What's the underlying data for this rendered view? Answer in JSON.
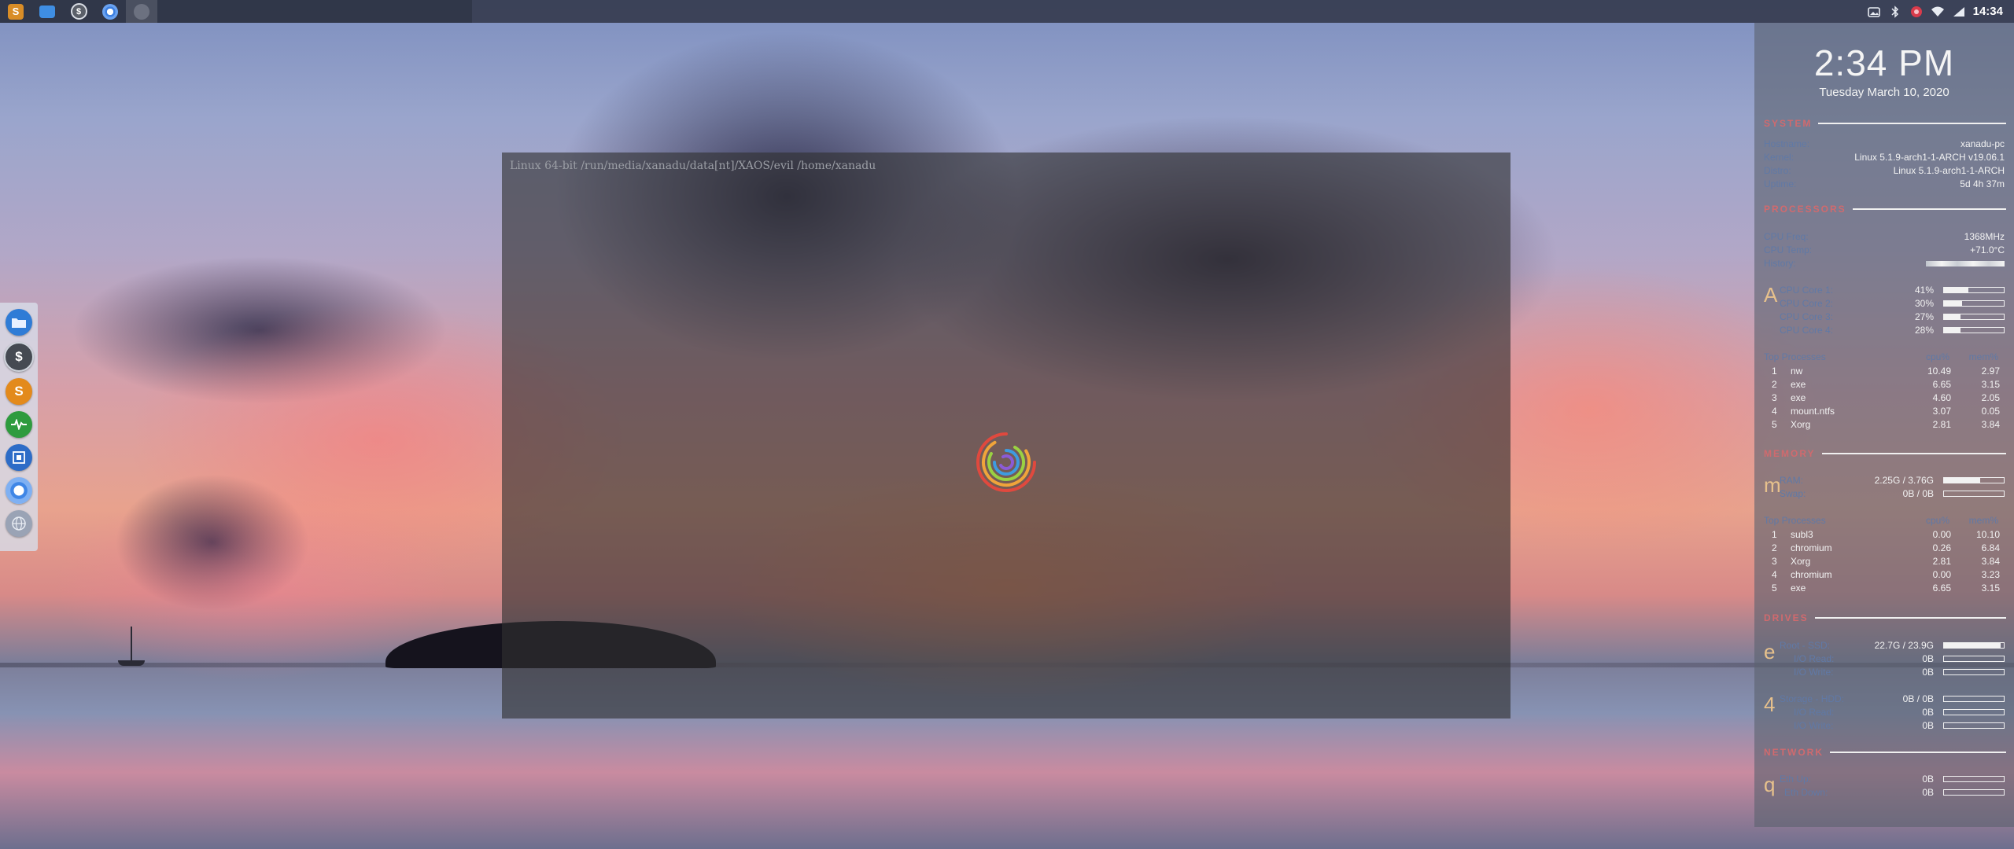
{
  "colors": {
    "conky_section_title": "#d06a6e",
    "conky_label": "#6079a6",
    "conky_value": "#f2f2f2",
    "conky_big_letter": "#e7c18c"
  },
  "topbar": {
    "apps": [
      {
        "icon": "sublime-text-icon",
        "glyph": "S",
        "color": "#d98d27"
      },
      {
        "icon": "folder-icon",
        "glyph": "",
        "color": "#3f8ee3"
      },
      {
        "icon": "terminal-icon",
        "glyph": "$",
        "color": "#5a5f69"
      },
      {
        "icon": "chromium-icon",
        "glyph": "",
        "color": "#3c7fe0"
      },
      {
        "icon": "system-monitor-icon",
        "glyph": "",
        "color": "#6c7180"
      }
    ],
    "tray_icons": [
      "screenshot-icon",
      "bluetooth-icon",
      "notification-icon",
      "wifi-icon",
      "battery-icon"
    ],
    "time": "14:34"
  },
  "dock": {
    "items": [
      {
        "name": "files",
        "icon": "folder-icon",
        "glyph": "▭",
        "color": "#2f7cd6"
      },
      {
        "name": "terminal",
        "icon": "terminal-icon",
        "glyph": "$",
        "color": "#454a52"
      },
      {
        "name": "sublime-text",
        "icon": "sublime-text-icon",
        "glyph": "S",
        "color": "#e38a1c"
      },
      {
        "name": "system-monitor",
        "icon": "activity-icon",
        "glyph": "∿",
        "color": "#2e9b3e"
      },
      {
        "name": "screenshot",
        "icon": "screenshot-icon",
        "glyph": "⬚",
        "color": "#2d6cc7"
      },
      {
        "name": "chromium",
        "icon": "chromium-icon",
        "glyph": "◎",
        "color": "#3f86e6"
      },
      {
        "name": "network",
        "icon": "globe-icon",
        "glyph": "⊕",
        "color": "#9aa3b5"
      }
    ]
  },
  "terminal": {
    "text": "Linux 64-bit /run/media/xanadu/data[nt]/XAOS/evil /home/xanadu"
  },
  "conky": {
    "time": "2:34 PM",
    "date": "Tuesday March 10, 2020",
    "system": {
      "title": "SYSTEM",
      "rows": [
        {
          "label": "Hostname:",
          "value": "xanadu-pc"
        },
        {
          "label": "Kernel:",
          "value": "Linux 5.1.9-arch1-1-ARCH v19.06.1"
        },
        {
          "label": "Distro:",
          "value": "Linux 5.1.9-arch1-1-ARCH"
        },
        {
          "label": "Uptime:",
          "value": "5d 4h 37m"
        }
      ]
    },
    "processors": {
      "title": "PROCESSORS",
      "rows": [
        {
          "label": "CPU Freq:",
          "value": "1368MHz"
        },
        {
          "label": "CPU Temp:",
          "value": "+71.0°C"
        },
        {
          "label": "History:",
          "value": ""
        }
      ],
      "letter": "A",
      "cores": [
        {
          "label": "CPU Core 1:",
          "pct": "41%",
          "fill": 0.41
        },
        {
          "label": "CPU Core 2:",
          "pct": "30%",
          "fill": 0.3
        },
        {
          "label": "CPU Core 3:",
          "pct": "27%",
          "fill": 0.27
        },
        {
          "label": "CPU Core 4:",
          "pct": "28%",
          "fill": 0.28
        }
      ],
      "top_header": {
        "name": "Top Processes",
        "col_a": "cpu%",
        "col_b": "mem%"
      },
      "top": [
        {
          "n": "1",
          "name": "nw",
          "a": "10.49",
          "b": "2.97"
        },
        {
          "n": "2",
          "name": "exe",
          "a": "6.65",
          "b": "3.15"
        },
        {
          "n": "3",
          "name": "exe",
          "a": "4.60",
          "b": "2.05"
        },
        {
          "n": "4",
          "name": "mount.ntfs",
          "a": "3.07",
          "b": "0.05"
        },
        {
          "n": "5",
          "name": "Xorg",
          "a": "2.81",
          "b": "3.84"
        }
      ]
    },
    "memory": {
      "title": "MEMORY",
      "letter": "m",
      "rows": [
        {
          "label": "RAM:",
          "value": "2.25G / 3.76G",
          "fill": 0.6
        },
        {
          "label": "Swap:",
          "value": "0B / 0B",
          "fill": 0.0
        }
      ],
      "top_header": {
        "name": "Top Processes",
        "col_a": "cpu%",
        "col_b": "mem%"
      },
      "top": [
        {
          "n": "1",
          "name": "subl3",
          "a": "0.00",
          "b": "10.10"
        },
        {
          "n": "2",
          "name": "chromium",
          "a": "0.26",
          "b": "6.84"
        },
        {
          "n": "3",
          "name": "Xorg",
          "a": "2.81",
          "b": "3.84"
        },
        {
          "n": "4",
          "name": "chromium",
          "a": "0.00",
          "b": "3.23"
        },
        {
          "n": "5",
          "name": "exe",
          "a": "6.65",
          "b": "3.15"
        }
      ]
    },
    "drives": {
      "title": "DRIVES",
      "root_letter": "e",
      "root": [
        {
          "label": "Root - SSD:",
          "value": "22.7G / 23.9G",
          "fill": 0.95
        },
        {
          "label": "I/O Read:",
          "value": "0B",
          "fill": 0.0
        },
        {
          "label": "I/O Write:",
          "value": "0B",
          "fill": 0.0
        }
      ],
      "storage_letter": "4",
      "storage": [
        {
          "label": "Storage - HDD:",
          "value": "0B / 0B",
          "fill": 0.0
        },
        {
          "label": "I/O Read:",
          "value": "0B",
          "fill": 0.0
        },
        {
          "label": "I/O Write:",
          "value": "0B",
          "fill": 0.0
        }
      ]
    },
    "network": {
      "title": "NETWORK",
      "letter": "q",
      "rows": [
        {
          "label": "Eth Up:",
          "value": "0B",
          "fill": 0.0
        },
        {
          "label": "Eth Down:",
          "value": "0B",
          "fill": 0.0
        }
      ]
    }
  }
}
